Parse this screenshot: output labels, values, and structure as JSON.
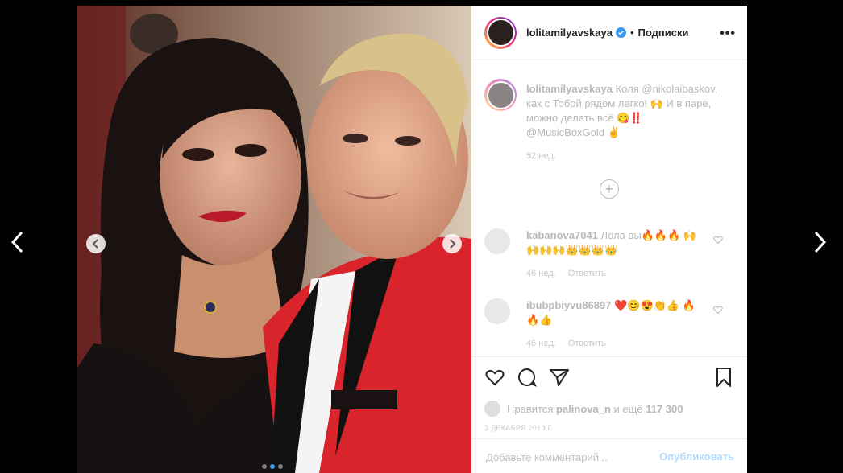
{
  "post": {
    "username": "lolitamilyavskaya",
    "separator": "•",
    "follow_label": "Подписки",
    "more_label": "•••"
  },
  "caption": {
    "username": "lolitamilyavskaya",
    "text": "Коля @nikolaibaskov, как с Тобой рядом легко! 🙌 И в паре, можно делать всё 😋‼️ @MusicBoxGold ✌️",
    "time": "52 нед."
  },
  "comments": [
    {
      "username": "kabanova7041",
      "text": "Лола вы🔥🔥🔥 🙌🙌🙌🙌👑👑👑👑",
      "time": "46 нед.",
      "reply": "Ответить"
    },
    {
      "username": "ibubpbiyvu86897",
      "text": "❤️😊😍👏👍 🔥🔥👍",
      "time": "46 нед.",
      "reply": "Ответить"
    }
  ],
  "likes": {
    "prefix": "Нравится",
    "user": "palinova_n",
    "suffix": "и ещё",
    "count": "117 300"
  },
  "date": "3 ДЕКАБРЯ 2019 Г.",
  "comment_box": {
    "placeholder": "Добавьте комментарий...",
    "publish_label": "Опубликовать"
  },
  "colors": {
    "accent": "#3897f0",
    "verified": "#3897f0",
    "jacket_red": "#d8242a"
  },
  "icons": [
    "chevron-left-icon",
    "chevron-right-icon",
    "heart-icon",
    "comment-icon",
    "share-icon",
    "bookmark-icon",
    "verified-icon",
    "plus-circle-icon"
  ]
}
